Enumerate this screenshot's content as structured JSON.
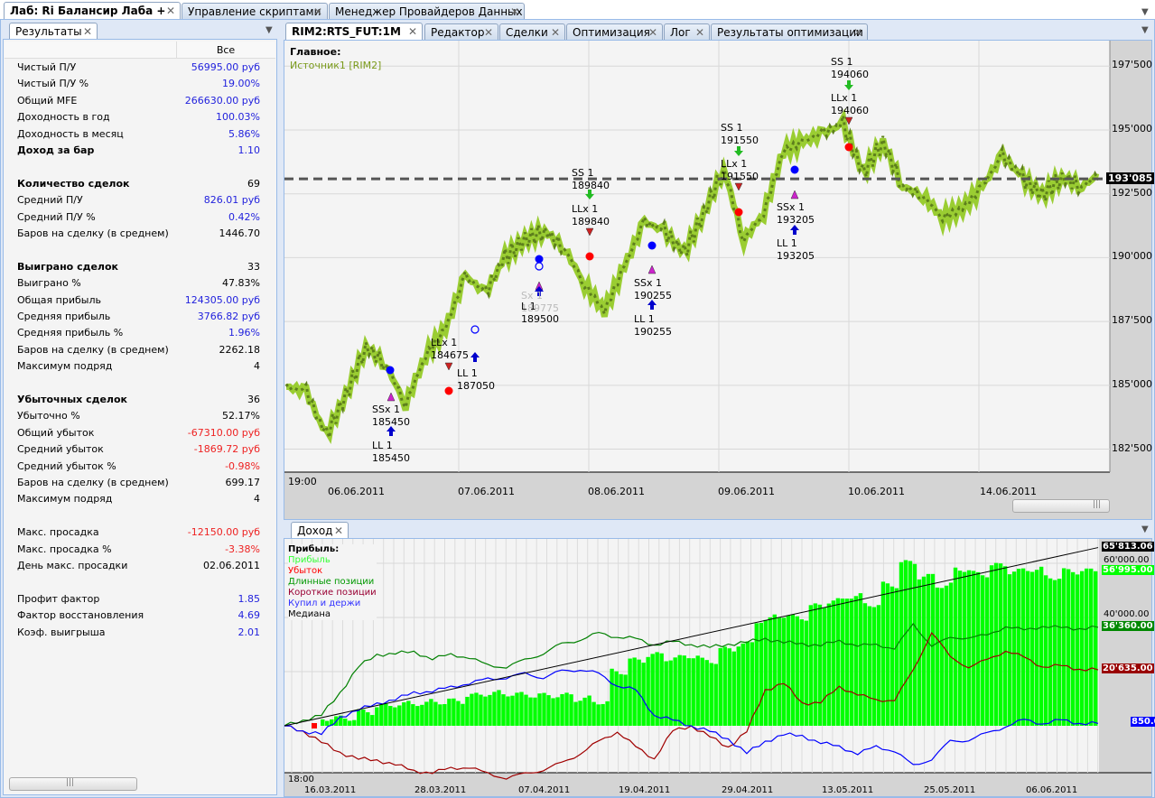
{
  "top_tabs": [
    "Лаб: Ri Балансир Лаба +",
    "Управление скриптами",
    "Менеджер Провайдеров Данных"
  ],
  "left_panel": {
    "tab": "Результаты",
    "column_header": "Все",
    "rows": [
      {
        "label": "Чистый П/У",
        "value": "56995.00 руб",
        "color": "blue"
      },
      {
        "label": "Чистый П/У %",
        "value": "19.00%",
        "color": "blue"
      },
      {
        "label": "Общий MFE",
        "value": "266630.00 руб",
        "color": "blue"
      },
      {
        "label": "Доходность в год",
        "value": "100.03%",
        "color": "blue"
      },
      {
        "label": "Доходность в месяц",
        "value": "5.86%",
        "color": "blue"
      },
      {
        "label": "Доход за бар",
        "value": "1.10",
        "color": "blue",
        "bold": true
      },
      {},
      {
        "label": "Количество сделок",
        "value": "69",
        "color": "black",
        "bold": true
      },
      {
        "label": "Средний П/У",
        "value": "826.01 руб",
        "color": "blue"
      },
      {
        "label": "Средний П/У %",
        "value": "0.42%",
        "color": "blue"
      },
      {
        "label": "Баров на сделку (в среднем)",
        "value": "1446.70",
        "color": "black"
      },
      {},
      {
        "label": "Выиграно сделок",
        "value": "33",
        "color": "black",
        "bold": true
      },
      {
        "label": "Выиграно %",
        "value": "47.83%",
        "color": "black"
      },
      {
        "label": "Общая прибыль",
        "value": "124305.00 руб",
        "color": "blue"
      },
      {
        "label": "Средняя прибыль",
        "value": "3766.82 руб",
        "color": "blue"
      },
      {
        "label": "Средняя прибыль %",
        "value": "1.96%",
        "color": "blue"
      },
      {
        "label": "Баров на сделку (в среднем)",
        "value": "2262.18",
        "color": "black"
      },
      {
        "label": "Максимум подряд",
        "value": "4",
        "color": "black"
      },
      {},
      {
        "label": "Убыточных сделок",
        "value": "36",
        "color": "black",
        "bold": true
      },
      {
        "label": "Убыточно %",
        "value": "52.17%",
        "color": "black"
      },
      {
        "label": "Общий убыток",
        "value": "-67310.00 руб",
        "color": "red"
      },
      {
        "label": "Средний убыток",
        "value": "-1869.72 руб",
        "color": "red"
      },
      {
        "label": "Средний убыток %",
        "value": "-0.98%",
        "color": "red"
      },
      {
        "label": "Баров на сделку (в среднем)",
        "value": "699.17",
        "color": "black"
      },
      {
        "label": "Максимум подряд",
        "value": "4",
        "color": "black"
      },
      {},
      {
        "label": "Макс. просадка",
        "value": "-12150.00 руб",
        "color": "red"
      },
      {
        "label": "Макс. просадка %",
        "value": "-3.38%",
        "color": "red"
      },
      {
        "label": "День макс. просадки",
        "value": "02.06.2011",
        "color": "black"
      },
      {},
      {
        "label": "Профит фактор",
        "value": "1.85",
        "color": "blue"
      },
      {
        "label": "Фактор восстановления",
        "value": "4.69",
        "color": "blue"
      },
      {
        "label": "Коэф. выигрыша",
        "value": "2.01",
        "color": "blue"
      }
    ]
  },
  "chart_tabs": [
    "RIM2:RTS_FUT:1M",
    "Редактор",
    "Сделки",
    "Оптимизация",
    "Лог",
    "Результаты оптимизации"
  ],
  "colors": {
    "price_light": "#9acd32",
    "price_dark": "#5d7f1c",
    "profit": "#00ff00",
    "long": "#008000",
    "short": "#a00000",
    "buyhold": "#0000ff",
    "median": "#000000"
  },
  "chart_data": [
    {
      "type": "line",
      "title": "Главное:",
      "legend": [
        "Источник1 [RIM2]"
      ],
      "time_start": "19:00",
      "xticks": [
        "06.06.2011",
        "07.06.2011",
        "08.06.2011",
        "09.06.2011",
        "10.06.2011",
        "14.06.2011"
      ],
      "yticks": [
        "197'500",
        "195'000",
        "192'500",
        "190'000",
        "187'500",
        "185'000",
        "182'500"
      ],
      "ytick_values": [
        197500,
        195000,
        192500,
        190000,
        187500,
        185000,
        182500
      ],
      "ylim": [
        181600,
        198500
      ],
      "last_price": 193085,
      "last_price_label": "193'085",
      "prices": [
        184940,
        184770,
        183030,
        184600,
        186510,
        185820,
        184250,
        186160,
        187210,
        189300,
        188610,
        190000,
        190700,
        191050,
        190350,
        188950,
        187910,
        189650,
        191400,
        191050,
        190170,
        191740,
        193490,
        190700,
        191740,
        194190,
        194540,
        194880,
        195230,
        193310,
        194540,
        192790,
        192440,
        191570,
        191920,
        192790,
        194010,
        193140,
        192440,
        193140,
        192790,
        193310
      ],
      "annotations": [
        {
          "lines": [
            "SSx 1",
            "185450"
          ]
        },
        {
          "lines": [
            "LL 1",
            "185450"
          ]
        },
        {
          "lines": [
            "LLx 1",
            "184675"
          ]
        },
        {
          "lines": [
            "LL 1",
            "187050"
          ]
        },
        {
          "lines": [
            "Sx 1",
            "189775"
          ]
        },
        {
          "lines": [
            "L 1",
            "189500"
          ]
        },
        {
          "lines": [
            "SS 1",
            "189840"
          ]
        },
        {
          "lines": [
            "LLx 1",
            "189840"
          ]
        },
        {
          "lines": [
            "SSx 1",
            "190255"
          ]
        },
        {
          "lines": [
            "LL 1",
            "190255"
          ]
        },
        {
          "lines": [
            "SS 1",
            "191550"
          ]
        },
        {
          "lines": [
            "LLx 1",
            "191550"
          ]
        },
        {
          "lines": [
            "SSx 1",
            "193205"
          ]
        },
        {
          "lines": [
            "LL 1",
            "193205"
          ]
        },
        {
          "lines": [
            "SS 1",
            "194060"
          ]
        },
        {
          "lines": [
            "LLx 1",
            "194060"
          ]
        }
      ]
    },
    {
      "type": "bar",
      "title": "Прибыль:",
      "tab": "Доход",
      "legend": [
        "Прибыль",
        "Убыток",
        "Длинные позиции",
        "Короткие позиции",
        "Купил и держи",
        "Медиана"
      ],
      "time_start": "18:00",
      "xticks": [
        "16.03.2011",
        "28.03.2011",
        "07.04.2011",
        "19.04.2011",
        "29.04.2011",
        "13.05.2011",
        "25.05.2011",
        "06.06.2011"
      ],
      "yticks": [
        "60'000.00",
        "40'000.00"
      ],
      "ytick_values": [
        60000,
        40000
      ],
      "value_labels": [
        "65'813.06",
        "56'995.00",
        "36'360.00",
        "20'635.00",
        "850.00"
      ],
      "profit": [
        0,
        0,
        3000,
        3000,
        5000,
        7000,
        8000,
        8500,
        9000,
        9000,
        11000,
        12000,
        12000,
        11500,
        11000,
        11000,
        10000,
        9000,
        20000,
        24000,
        26000,
        25000,
        26000,
        24000,
        28000,
        30000,
        39000,
        41000,
        40000,
        44000,
        46000,
        48000,
        45000,
        52000,
        60000,
        55000,
        52000,
        58000,
        56000,
        59000,
        57000,
        58000,
        55000,
        57000,
        57000
      ],
      "long": [
        0,
        2000,
        4000,
        12000,
        22000,
        26000,
        27000,
        27000,
        25000,
        26000,
        25500,
        22000,
        22000,
        24000,
        27000,
        30000,
        32000,
        34000,
        33000,
        32000,
        30000,
        31000,
        30000,
        29000,
        30000,
        31000,
        32000,
        31000,
        30000,
        30000,
        31000,
        30000,
        29500,
        29000,
        37000,
        30000,
        32000,
        33000,
        33000,
        37000,
        35000,
        37000,
        36000,
        36000,
        36360
      ],
      "short": [
        0,
        -2000,
        -6000,
        -10000,
        -12000,
        -13000,
        -14000,
        -17000,
        -17000,
        -16000,
        -15000,
        -18000,
        -19000,
        -18000,
        -16000,
        -14000,
        -10000,
        -6000,
        -2000,
        -8000,
        -12000,
        -2000,
        0,
        -4000,
        -8000,
        -2000,
        13000,
        16000,
        8000,
        9000,
        14000,
        12000,
        9000,
        10000,
        20000,
        35000,
        25000,
        22000,
        24000,
        28000,
        25000,
        22000,
        22000,
        21000,
        20635
      ],
      "buyhold": [
        0,
        -2000,
        -3000,
        3000,
        6000,
        8000,
        10000,
        12000,
        13000,
        14000,
        16000,
        17000,
        18000,
        19000,
        18000,
        20000,
        21000,
        19000,
        15000,
        13000,
        4000,
        2000,
        0,
        -2000,
        -5000,
        -10000,
        -6000,
        -3000,
        -4000,
        -6000,
        -8000,
        -10000,
        -8000,
        -9000,
        -15000,
        -12000,
        -6000,
        -5000,
        -3000,
        0,
        2000,
        1000,
        2000,
        1000,
        850
      ],
      "median": [
        0,
        65813.06
      ]
    }
  ]
}
